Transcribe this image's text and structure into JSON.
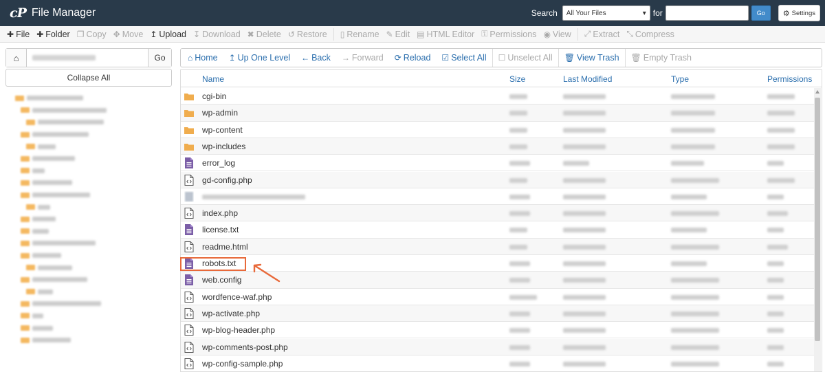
{
  "header": {
    "logo_mark": "cP",
    "title": "File Manager",
    "search_label": "Search",
    "search_scope": "All Your Files",
    "for_label": "for",
    "go_label": "Go",
    "settings_label": "Settings",
    "bg_color": "#293a4a"
  },
  "toolbar": {
    "items": [
      {
        "label": "File",
        "icon": "plus-icon",
        "enabled": true
      },
      {
        "label": "Folder",
        "icon": "plus-icon",
        "enabled": true
      },
      {
        "label": "Copy",
        "icon": "copy-icon",
        "enabled": false
      },
      {
        "label": "Move",
        "icon": "move-icon",
        "enabled": false
      },
      {
        "label": "Upload",
        "icon": "upload-icon",
        "enabled": true
      },
      {
        "label": "Download",
        "icon": "download-icon",
        "enabled": false
      },
      {
        "label": "Delete",
        "icon": "delete-icon",
        "enabled": false
      },
      {
        "label": "Restore",
        "icon": "restore-icon",
        "enabled": false
      },
      {
        "label": "Rename",
        "icon": "rename-icon",
        "enabled": false
      },
      {
        "label": "Edit",
        "icon": "edit-icon",
        "enabled": false
      },
      {
        "label": "HTML Editor",
        "icon": "html-editor-icon",
        "enabled": false
      },
      {
        "label": "Permissions",
        "icon": "key-icon",
        "enabled": false
      },
      {
        "label": "View",
        "icon": "eye-icon",
        "enabled": false
      },
      {
        "label": "Extract",
        "icon": "extract-icon",
        "enabled": false
      },
      {
        "label": "Compress",
        "icon": "compress-icon",
        "enabled": false
      }
    ]
  },
  "left": {
    "go_label": "Go",
    "collapse_label": "Collapse All"
  },
  "actions": {
    "home": "Home",
    "up": "Up One Level",
    "back": "Back",
    "forward": "Forward",
    "reload": "Reload",
    "select_all": "Select All",
    "unselect_all": "Unselect All",
    "view_trash": "View Trash",
    "empty_trash": "Empty Trash"
  },
  "table": {
    "columns": {
      "name": "Name",
      "size": "Size",
      "modified": "Last Modified",
      "type": "Type",
      "permissions": "Permissions"
    },
    "rows": [
      {
        "name": "cgi-bin",
        "kind": "folder"
      },
      {
        "name": "wp-admin",
        "kind": "folder"
      },
      {
        "name": "wp-content",
        "kind": "folder"
      },
      {
        "name": "wp-includes",
        "kind": "folder"
      },
      {
        "name": "error_log",
        "kind": "text"
      },
      {
        "name": "gd-config.php",
        "kind": "code"
      },
      {
        "name": "",
        "kind": "blurred"
      },
      {
        "name": "index.php",
        "kind": "code"
      },
      {
        "name": "license.txt",
        "kind": "text"
      },
      {
        "name": "readme.html",
        "kind": "code"
      },
      {
        "name": "robots.txt",
        "kind": "text"
      },
      {
        "name": "web.config",
        "kind": "text"
      },
      {
        "name": "wordfence-waf.php",
        "kind": "code"
      },
      {
        "name": "wp-activate.php",
        "kind": "code"
      },
      {
        "name": "wp-blog-header.php",
        "kind": "code"
      },
      {
        "name": "wp-comments-post.php",
        "kind": "code"
      },
      {
        "name": "wp-config-sample.php",
        "kind": "code"
      }
    ]
  },
  "annotation": {
    "highlighted_file": "robots.txt",
    "color": "#e8693a"
  }
}
